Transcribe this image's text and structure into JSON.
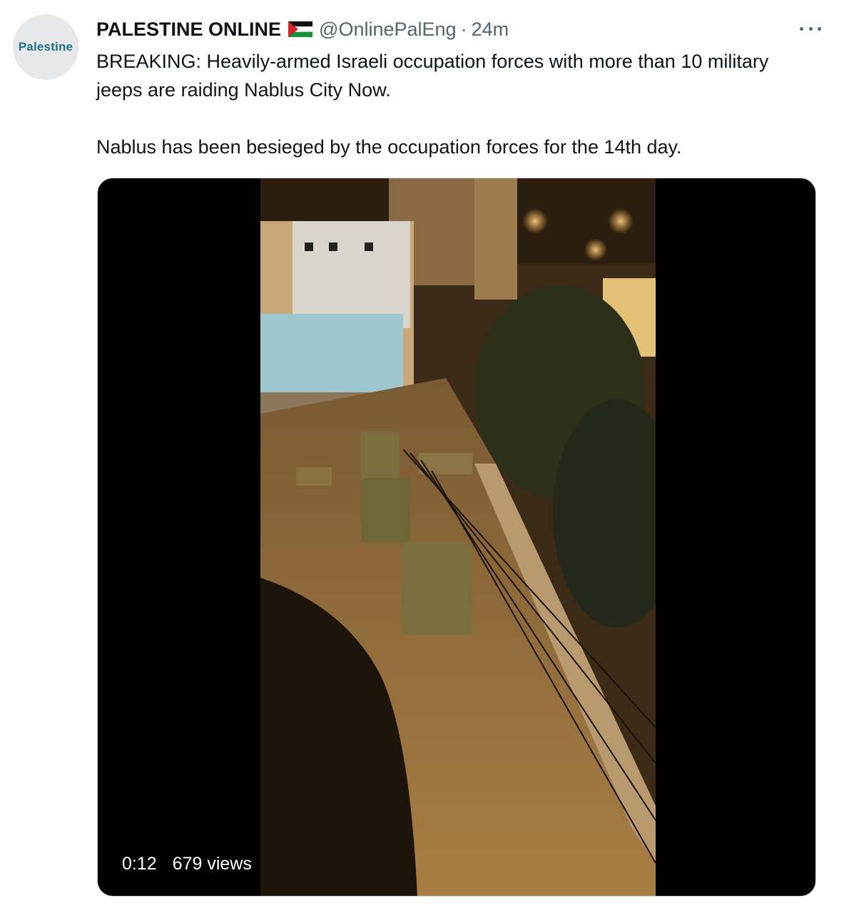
{
  "author": {
    "avatar_text": "Palestine",
    "name": "PALESTINE ONLINE",
    "flag_icon": "palestine-flag-icon",
    "handle": "@OnlinePalEng",
    "separator": "·",
    "time": "24m"
  },
  "tweet": {
    "paragraphs": [
      "BREAKING: Heavily-armed Israeli occupation forces with more than 10 military jeeps are raiding Nablus City Now.",
      "Nablus has been besieged by the occupation forces for the 14th day."
    ]
  },
  "video": {
    "duration": "0:12",
    "views": "679 views"
  },
  "colors": {
    "text": "#0f1419",
    "secondary": "#536471",
    "media_background": "#000000"
  }
}
